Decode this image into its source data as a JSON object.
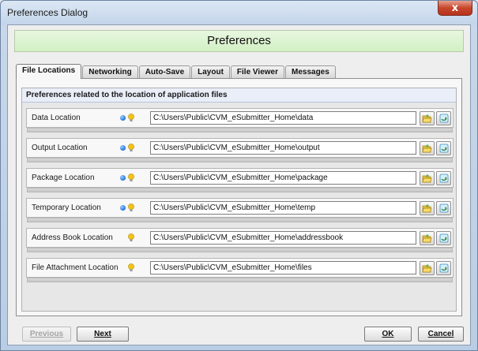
{
  "window": {
    "title": "Preferences Dialog",
    "close_glyph": "x"
  },
  "header": {
    "title": "Preferences"
  },
  "tabs": [
    {
      "label": "File Locations",
      "active": true
    },
    {
      "label": "Networking",
      "active": false
    },
    {
      "label": "Auto-Save",
      "active": false
    },
    {
      "label": "Layout",
      "active": false
    },
    {
      "label": "File Viewer",
      "active": false
    },
    {
      "label": "Messages",
      "active": false
    }
  ],
  "file_locations": {
    "caption": "Preferences related to the location of application files",
    "rows": [
      {
        "label": "Data Location",
        "path": "C:\\Users\\Public\\CVM_eSubmitter_Home\\data",
        "indicators": [
          "blue-dot-icon",
          "lightbulb-icon"
        ]
      },
      {
        "label": "Output Location",
        "path": "C:\\Users\\Public\\CVM_eSubmitter_Home\\output",
        "indicators": [
          "blue-dot-icon",
          "lightbulb-icon"
        ]
      },
      {
        "label": "Package Location",
        "path": "C:\\Users\\Public\\CVM_eSubmitter_Home\\package",
        "indicators": [
          "blue-dot-icon",
          "lightbulb-icon"
        ]
      },
      {
        "label": "Temporary Location",
        "path": "C:\\Users\\Public\\CVM_eSubmitter_Home\\temp",
        "indicators": [
          "blue-dot-icon",
          "lightbulb-icon"
        ]
      },
      {
        "label": "Address Book Location",
        "path": "C:\\Users\\Public\\CVM_eSubmitter_Home\\addressbook",
        "indicators": [
          "lightbulb-icon"
        ]
      },
      {
        "label": "File Attachment Location",
        "path": "C:\\Users\\Public\\CVM_eSubmitter_Home\\files",
        "indicators": [
          "lightbulb-icon"
        ]
      }
    ],
    "row_buttons": [
      "folder-open-icon",
      "reset-default-icon"
    ]
  },
  "buttons": {
    "previous": "Previous",
    "next": "Next",
    "ok": "OK",
    "cancel": "Cancel"
  },
  "colors": {
    "header_band": "#d2f0c4",
    "close_button": "#c6462c",
    "indicator_blue": "#1f6fd6",
    "indicator_bulb": "#f2c318"
  }
}
